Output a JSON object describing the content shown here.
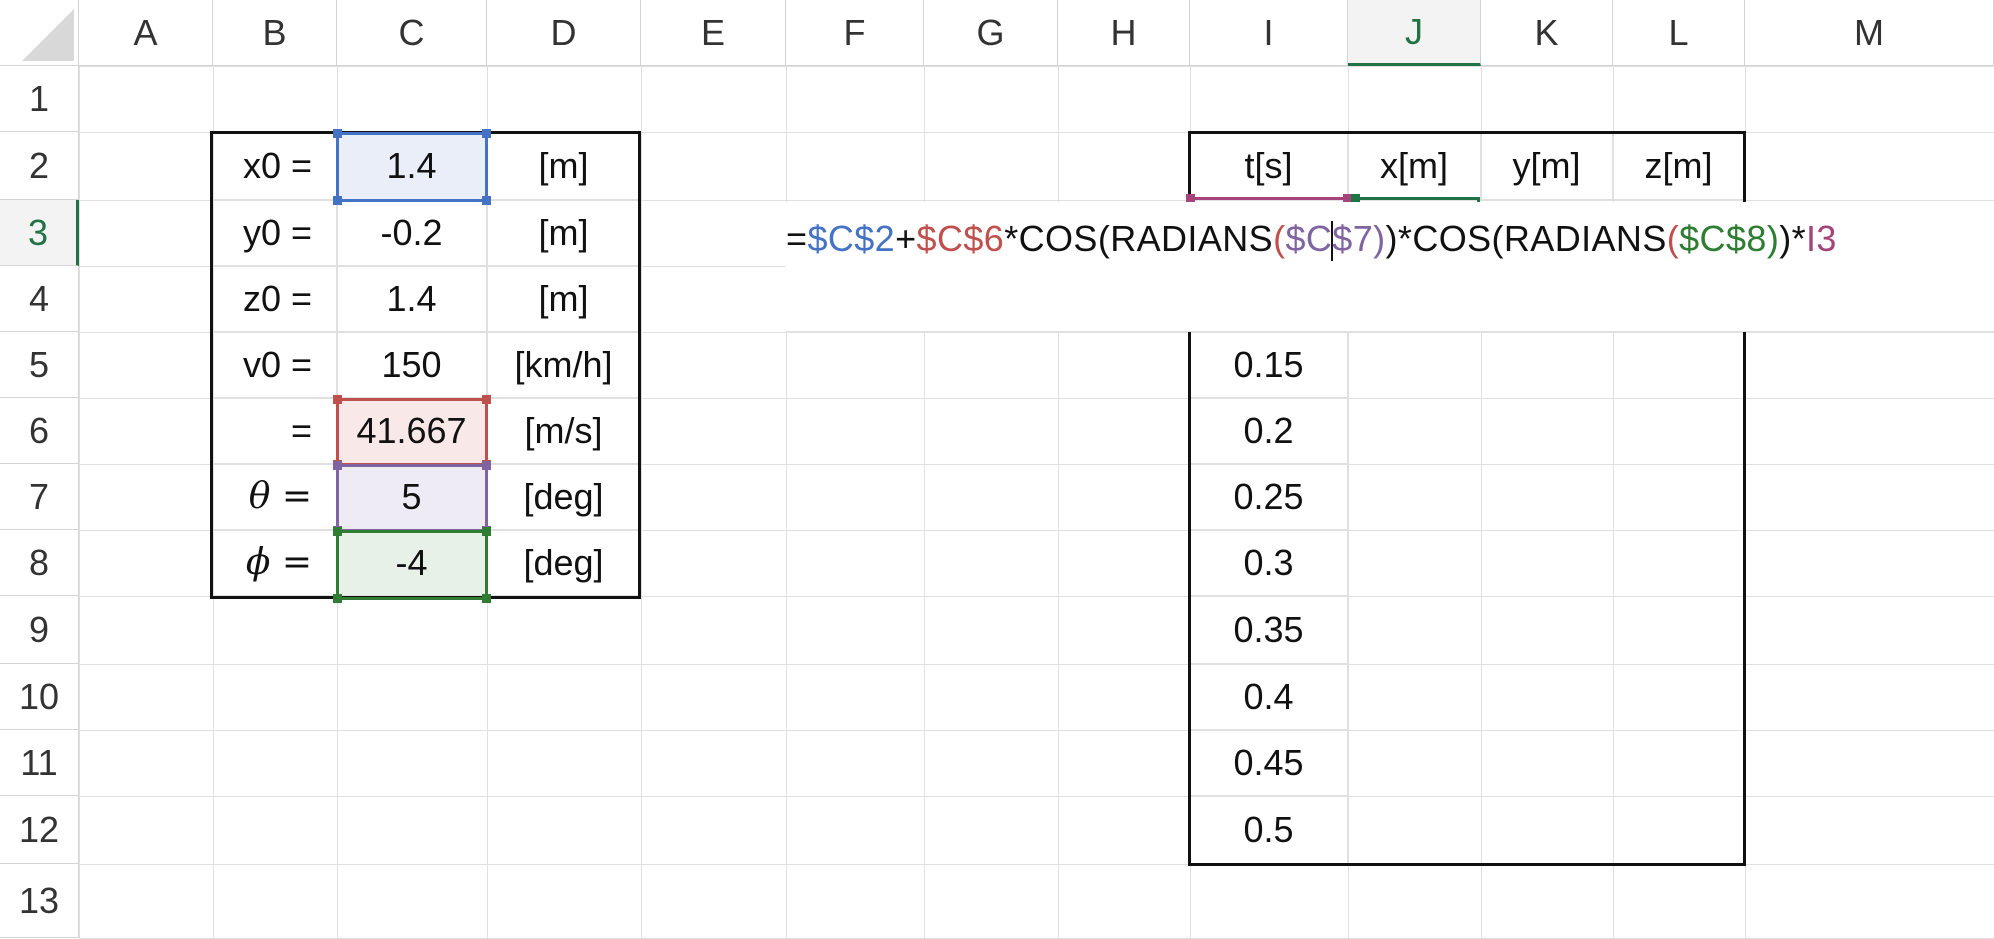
{
  "columns": [
    "A",
    "B",
    "C",
    "D",
    "E",
    "F",
    "G",
    "H",
    "I",
    "J",
    "K",
    "L",
    "M"
  ],
  "rows": [
    "1",
    "2",
    "3",
    "4",
    "5",
    "6",
    "7",
    "8",
    "9",
    "10",
    "11",
    "12",
    "13"
  ],
  "active_column": "J",
  "active_row": "3",
  "params": [
    {
      "label": "x0 =",
      "value": "1.4",
      "unit": "[m]"
    },
    {
      "label": "y0 =",
      "value": "-0.2",
      "unit": "[m]"
    },
    {
      "label": "z0 =",
      "value": "1.4",
      "unit": "[m]"
    },
    {
      "label": "v0 =",
      "value": "150",
      "unit": "[km/h]"
    },
    {
      "label": "=",
      "value": "41.667",
      "unit": "[m/s]"
    },
    {
      "label": "θ =",
      "value": "5",
      "unit": "[deg]"
    },
    {
      "label": "ϕ =",
      "value": "-4",
      "unit": "[deg]"
    }
  ],
  "table_headers": [
    "t[s]",
    "x[m]",
    "y[m]",
    "z[m]"
  ],
  "time_values": [
    "0.15",
    "0.2",
    "0.25",
    "0.3",
    "0.35",
    "0.4",
    "0.45",
    "0.5"
  ],
  "formula_tokens": [
    {
      "text": "=",
      "color": "#111111"
    },
    {
      "text": "$C$2",
      "color": "#4472c4"
    },
    {
      "text": "+",
      "color": "#111111"
    },
    {
      "text": "$C$6",
      "color": "#c0504d"
    },
    {
      "text": "*COS(RADIANS",
      "color": "#111111"
    },
    {
      "text": "(",
      "color": "#c0504d"
    },
    {
      "text": "$C",
      "color": "#8064a2"
    },
    {
      "text": "$7",
      "color": "#8064a2"
    },
    {
      "text": ")",
      "color": "#8064a2"
    },
    {
      "text": ")*COS(RADIANS",
      "color": "#111111"
    },
    {
      "text": "(",
      "color": "#c0504d"
    },
    {
      "text": "$C$8",
      "color": "#2e7d32"
    },
    {
      "text": ")",
      "color": "#2e7d32"
    },
    {
      "text": ")*",
      "color": "#111111"
    },
    {
      "text": "I3",
      "color": "#a5447b"
    }
  ],
  "colors": {
    "ref_blue": "#4472c4",
    "ref_red": "#c0504d",
    "ref_purple": "#8064a2",
    "ref_green": "#2e7d32",
    "ref_pink": "#a5447b",
    "accent": "#217346"
  }
}
